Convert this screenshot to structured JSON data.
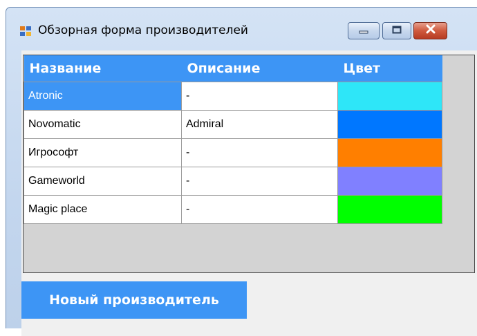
{
  "window": {
    "title": "Обзорная форма производителей",
    "icons": {
      "app": "form-app-icon",
      "minimize": "minimize-icon",
      "maximize": "maximize-icon",
      "close": "close-icon"
    }
  },
  "grid": {
    "columns": [
      "Название",
      "Описание",
      "Цвет"
    ],
    "rows": [
      {
        "name": "Atronic",
        "description": "-",
        "color": "#2ee6f8",
        "selected": true
      },
      {
        "name": "Novomatic",
        "description": "Admiral",
        "color": "#0077ff",
        "selected": false
      },
      {
        "name": "Игрософт",
        "description": "-",
        "color": "#ff7f00",
        "selected": false
      },
      {
        "name": "Gameworld",
        "description": "-",
        "color": "#8080ff",
        "selected": false
      },
      {
        "name": "Magic place",
        "description": "-",
        "color": "#00ff00",
        "selected": false
      }
    ]
  },
  "buttons": {
    "new_manufacturer": "Новый производитель"
  },
  "colors": {
    "accent": "#3d95f5"
  }
}
